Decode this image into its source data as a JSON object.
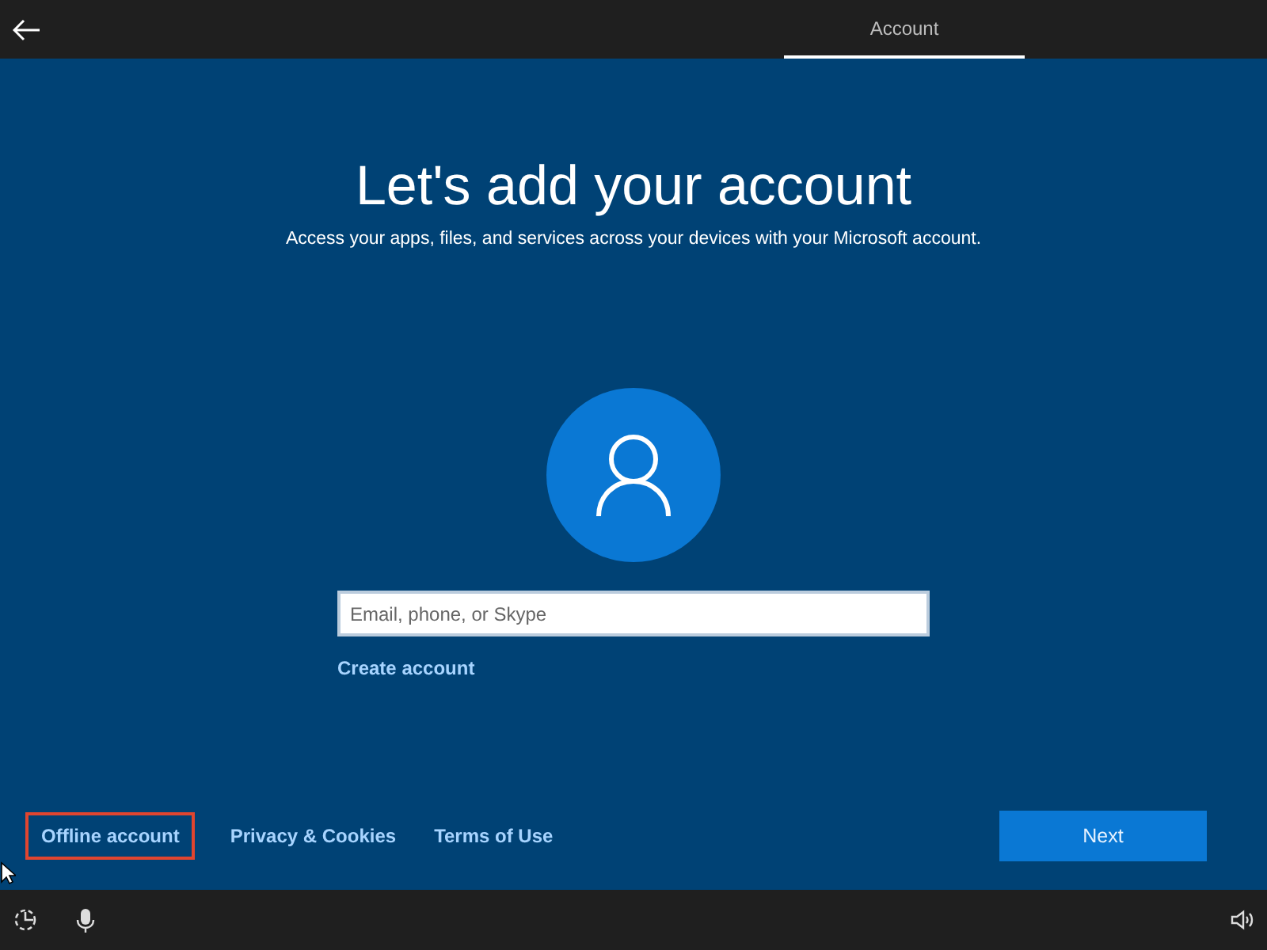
{
  "top_bar": {
    "tabs": [
      {
        "label": "Account",
        "selected": true
      }
    ]
  },
  "heading": "Let's add your account",
  "subtitle": "Access your apps, files, and services across your devices with your Microsoft account.",
  "sign_in": {
    "placeholder": "Email, phone, or Skype",
    "link": "Create account"
  },
  "footer_links": [
    {
      "label": "Offline account",
      "highlighted": true
    },
    {
      "label": "Privacy & Cookies",
      "highlighted": false
    },
    {
      "label": "Terms of Use",
      "highlighted": false
    }
  ],
  "next_button": "Next"
}
